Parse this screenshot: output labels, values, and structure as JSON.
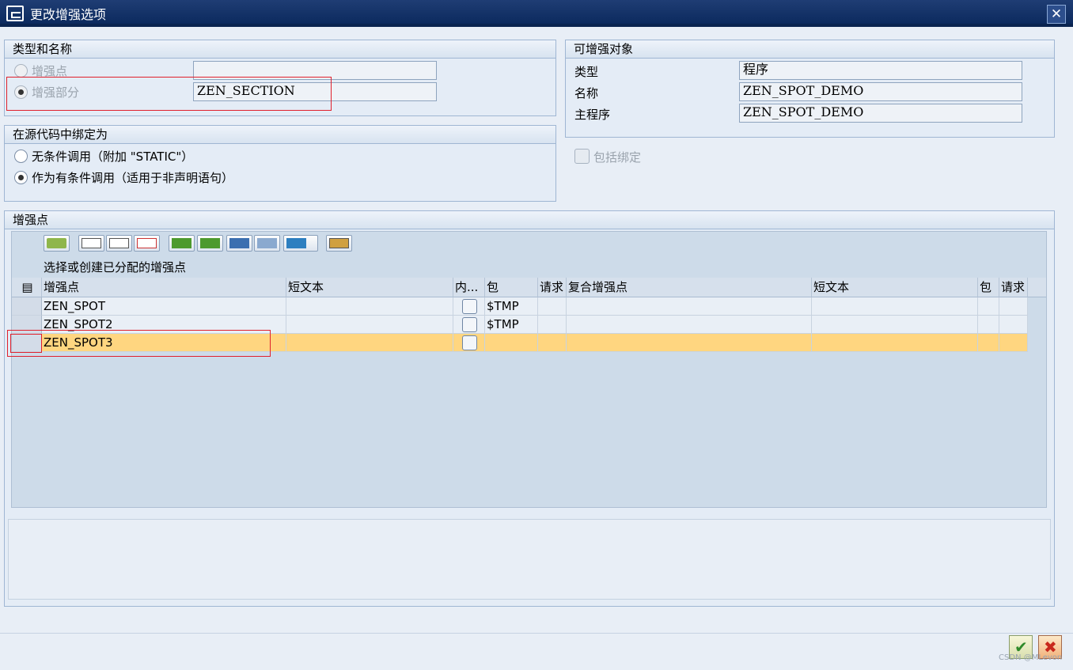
{
  "window": {
    "title": "更改增强选项",
    "close_label": "✕"
  },
  "type_name": {
    "header": "类型和名称",
    "spot_label": "增强点",
    "spot_value": "",
    "section_label": "增强部分",
    "section_value": "ZEN_SECTION"
  },
  "binding": {
    "header": "在源代码中绑定为",
    "opt1": "无条件调用（附加 \"STATIC\"）",
    "opt2": "作为有条件调用（适用于非声明语句）"
  },
  "object": {
    "header": "可增强对象",
    "type_label": "类型",
    "type_value": "程序",
    "name_label": "名称",
    "name_value": "ZEN_SPOT_DEMO",
    "main_label": "主程序",
    "main_value": "ZEN_SPOT_DEMO",
    "include_bind_label": "包括绑定"
  },
  "spots": {
    "header": "增强点",
    "instruction": "选择或创建已分配的增强点",
    "columns": [
      "增强点",
      "短文本",
      "内...",
      "包",
      "请求",
      "复合增强点",
      "短文本",
      "包",
      "请求"
    ],
    "rows": [
      {
        "spot": "ZEN_SPOT",
        "text": "",
        "package": "$TMP",
        "request": "",
        "composite": "",
        "ctext": "",
        "cpackage": "",
        "crequest": ""
      },
      {
        "spot": "ZEN_SPOT2",
        "text": "",
        "package": "$TMP",
        "request": "",
        "composite": "",
        "ctext": "",
        "cpackage": "",
        "crequest": ""
      },
      {
        "spot": "ZEN_SPOT3",
        "text": "",
        "package": "",
        "request": "",
        "composite": "",
        "ctext": "",
        "cpackage": "",
        "crequest": ""
      }
    ]
  },
  "toolbar_icons": [
    "details-icon",
    "new-icon",
    "delete-row-icon",
    "deselect-icon",
    "sort-asc-icon",
    "sort-desc-icon",
    "find-icon",
    "find-next-icon",
    "filter-icon",
    "layout-icon"
  ],
  "footer": {
    "ok": "✔",
    "cancel": "✖",
    "watermark": "CSDN @MLevon"
  },
  "colors": {
    "titlebar": "#0c2a5e",
    "selected_row": "#ffd680",
    "highlight": "#e0202c"
  }
}
